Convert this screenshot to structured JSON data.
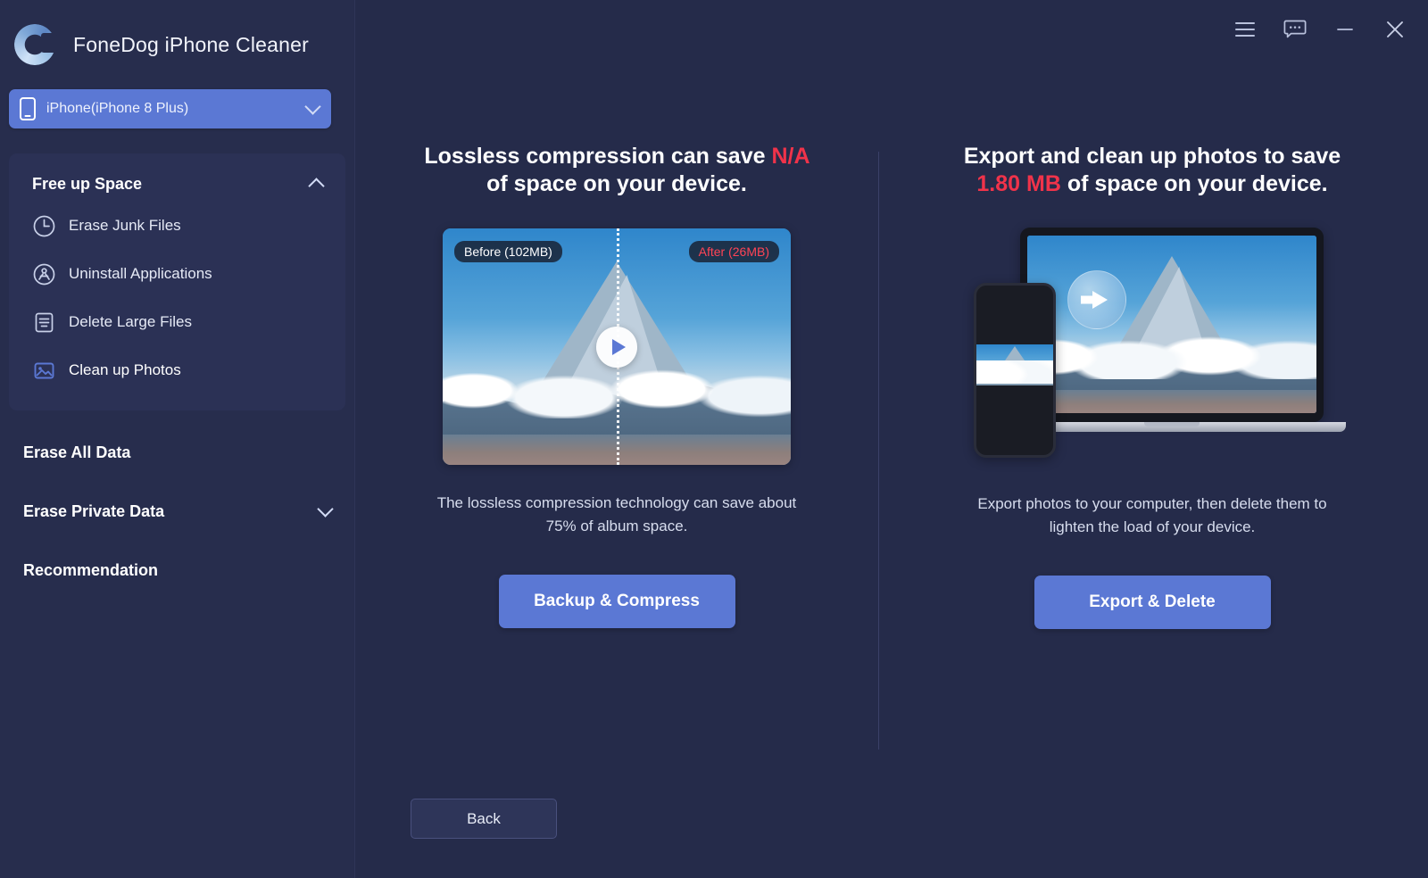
{
  "app": {
    "title": "FoneDog iPhone Cleaner",
    "logo_icon": "fonedog-c-logo"
  },
  "titlebar": {
    "buttons": [
      {
        "name": "menu-icon",
        "label": "☰"
      },
      {
        "name": "feedback-icon",
        "label": "…"
      },
      {
        "name": "minimize-icon",
        "label": "—"
      },
      {
        "name": "close-icon",
        "label": "✕"
      }
    ]
  },
  "device_selector": {
    "icon": "phone-icon",
    "value": "iPhone(iPhone 8 Plus)",
    "chevron": "chevron-down-icon"
  },
  "sidebar": {
    "group": {
      "label": "Free up Space",
      "expanded": true,
      "chevron": "chevron-up-icon",
      "items": [
        {
          "label": "Erase Junk Files",
          "icon": "clock-icon",
          "active": false
        },
        {
          "label": "Uninstall Applications",
          "icon": "uninstall-app-icon",
          "active": false
        },
        {
          "label": "Delete Large Files",
          "icon": "document-lines-icon",
          "active": false
        },
        {
          "label": "Clean up Photos",
          "icon": "photo-icon",
          "active": true
        }
      ]
    },
    "sections": [
      {
        "label": "Erase All Data",
        "chevron": ""
      },
      {
        "label": "Erase Private Data",
        "chevron": "chevron-down-icon"
      },
      {
        "label": "Recommendation",
        "chevron": ""
      }
    ]
  },
  "main": {
    "left_panel": {
      "title_pre": "Lossless compression can save ",
      "title_highlight": "N/A",
      "title_post": " of space on your device.",
      "media": {
        "before_tag": "Before (102MB)",
        "after_tag": "After (26MB)",
        "play_icon": "play-icon"
      },
      "description": "The lossless compression technology can save about 75% of album space.",
      "cta_label": "Backup & Compress"
    },
    "right_panel": {
      "title_pre": "Export and clean up photos to save ",
      "title_highlight": "1.80 MB",
      "title_post": " of space on your device.",
      "media": {
        "transfer_icon": "transfer-arrow-icon"
      },
      "description": "Export photos to your computer, then delete them to lighten the load of your device.",
      "cta_label": "Export & Delete"
    },
    "back_label": "Back"
  },
  "colors": {
    "window_bg": "#252b4a",
    "sidebar_bg": "#272d4d",
    "card_bg": "#2b3155",
    "accent": "#5b78d4",
    "highlight_red": "#f0334a",
    "text_primary": "#ffffff",
    "text_secondary": "#d7ddee"
  }
}
